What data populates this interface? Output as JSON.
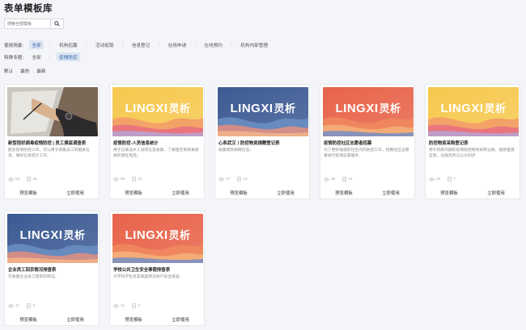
{
  "page_title": "表单模板库",
  "search": {
    "placeholder": "搜索全部模板"
  },
  "filters": {
    "scene": {
      "label": "使用场景:",
      "options": [
        "全部",
        "机构招募",
        "活动促销",
        "信息登记",
        "在线申请",
        "在线预约",
        "机构内部管理"
      ],
      "active": "全部"
    },
    "topic": {
      "label": "特殊专题:",
      "options": [
        "全部",
        "疫情防控"
      ],
      "active": "疫情防控"
    }
  },
  "sort": {
    "options": [
      "默认",
      "最热",
      "最新"
    ]
  },
  "thumb_brand": {
    "latin": "LINGXI",
    "cn": "灵析"
  },
  "cards": [
    {
      "title": "新型冠状病毒疫情防控 | 员工摸底调查表",
      "desc": "配合疫情防控工作，可以用于收集员工的相关信息，做好信息统计工作。",
      "views": "53",
      "uses": "46",
      "thumb": "photo",
      "preview": "预览模板",
      "use": "立即使用"
    },
    {
      "title": "疫情防控-人员信息统计",
      "desc": "用于记录返乡人员的信息收集，了解是否有病毒感染的潜在危险。",
      "views": "66",
      "uses": "22",
      "thumb": "yellow",
      "preview": "预览模板",
      "use": "立即使用"
    },
    {
      "title": "心系武汉丨防控物资捐赠登记表",
      "desc": "收集物资捐赠信息。",
      "views": "47",
      "uses": "13",
      "thumb": "blue",
      "preview": "预览模板",
      "use": "立即使用"
    },
    {
      "title": "疫情防控社区志愿者招募",
      "desc": "为了更好地组织社区内的防控工作，招募社区志愿者进行疫情志愿服务",
      "views": "40",
      "uses": "24",
      "thumb": "red",
      "preview": "预览模板",
      "use": "立即使用"
    },
    {
      "title": "防控物资采购登记表",
      "desc": "用于机构内部的疫情防控物资采购记录，能够直观监管，也能及时与公众同步",
      "views": "35",
      "uses": "7",
      "thumb": "yellow",
      "preview": "预览模板",
      "use": "立即使用"
    },
    {
      "title": "企业员工回京情况排查表",
      "desc": "可收集企业员工回京的情况。",
      "views": "27",
      "uses": "3",
      "thumb": "blue",
      "preview": "预览模板",
      "use": "立即使用"
    },
    {
      "title": "学校公共卫生安全事假排查表",
      "desc": "对学校学生及其家庭情况进行安全排查。",
      "views": "21",
      "uses": "2",
      "thumb": "red",
      "preview": "预览模板",
      "use": "立即使用"
    }
  ],
  "colors": {
    "accent": "#2f5fa8",
    "chip_active_bg": "#dde5f2",
    "yellow_top": "#f6c84e",
    "blue_top": "#3c5a93",
    "red_top": "#e8634a"
  }
}
